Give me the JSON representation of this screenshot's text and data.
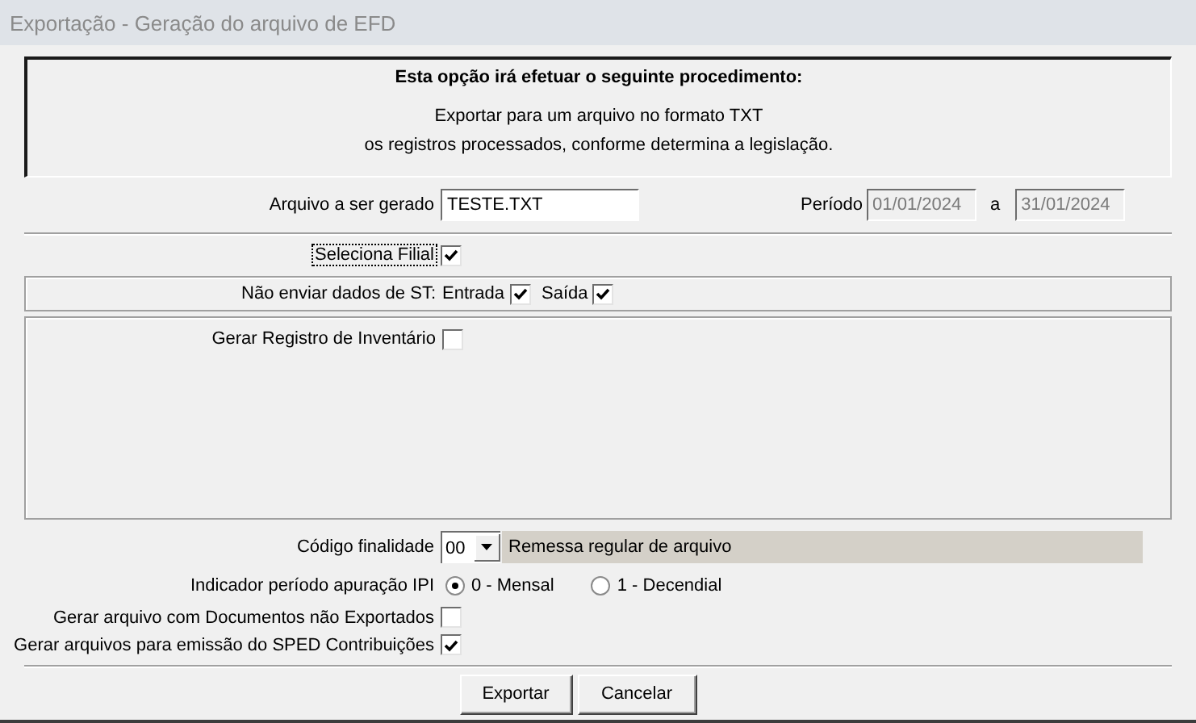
{
  "window": {
    "title": "Exportação - Geração do arquivo de EFD"
  },
  "info": {
    "heading": "Esta opção irá efetuar o seguinte procedimento:",
    "lines": [
      "Exportar para um arquivo no formato TXT",
      "os registros processados, conforme determina a legislação."
    ]
  },
  "file": {
    "label": "Arquivo a ser gerado",
    "value": "TESTE.TXT"
  },
  "period": {
    "label": "Período",
    "start": "01/01/2024",
    "separator": "a",
    "end": "31/01/2024",
    "disabled": true
  },
  "select_branch": {
    "label": "Seleciona Filial",
    "checked": true,
    "focused": true
  },
  "st": {
    "label": "Não enviar dados de ST:",
    "options": [
      {
        "label": "Entrada",
        "checked": true
      },
      {
        "label": "Saída",
        "checked": true
      }
    ]
  },
  "inventory": {
    "label": "Gerar Registro de Inventário",
    "checked": false
  },
  "purpose": {
    "label": "Código finalidade",
    "code": "00",
    "description": "Remessa regular de arquivo"
  },
  "ipi_period": {
    "label": "Indicador período apuração IPI",
    "options": [
      {
        "label": "0 - Mensal",
        "selected": true
      },
      {
        "label": "1 - Decendial",
        "selected": false
      }
    ]
  },
  "options": [
    {
      "label": "Gerar arquivo com Documentos não Exportados",
      "checked": false
    },
    {
      "label": "Gerar arquivos para emissão do SPED Contribuições",
      "checked": true
    }
  ],
  "buttons": [
    "Exportar",
    "Cancelar"
  ]
}
